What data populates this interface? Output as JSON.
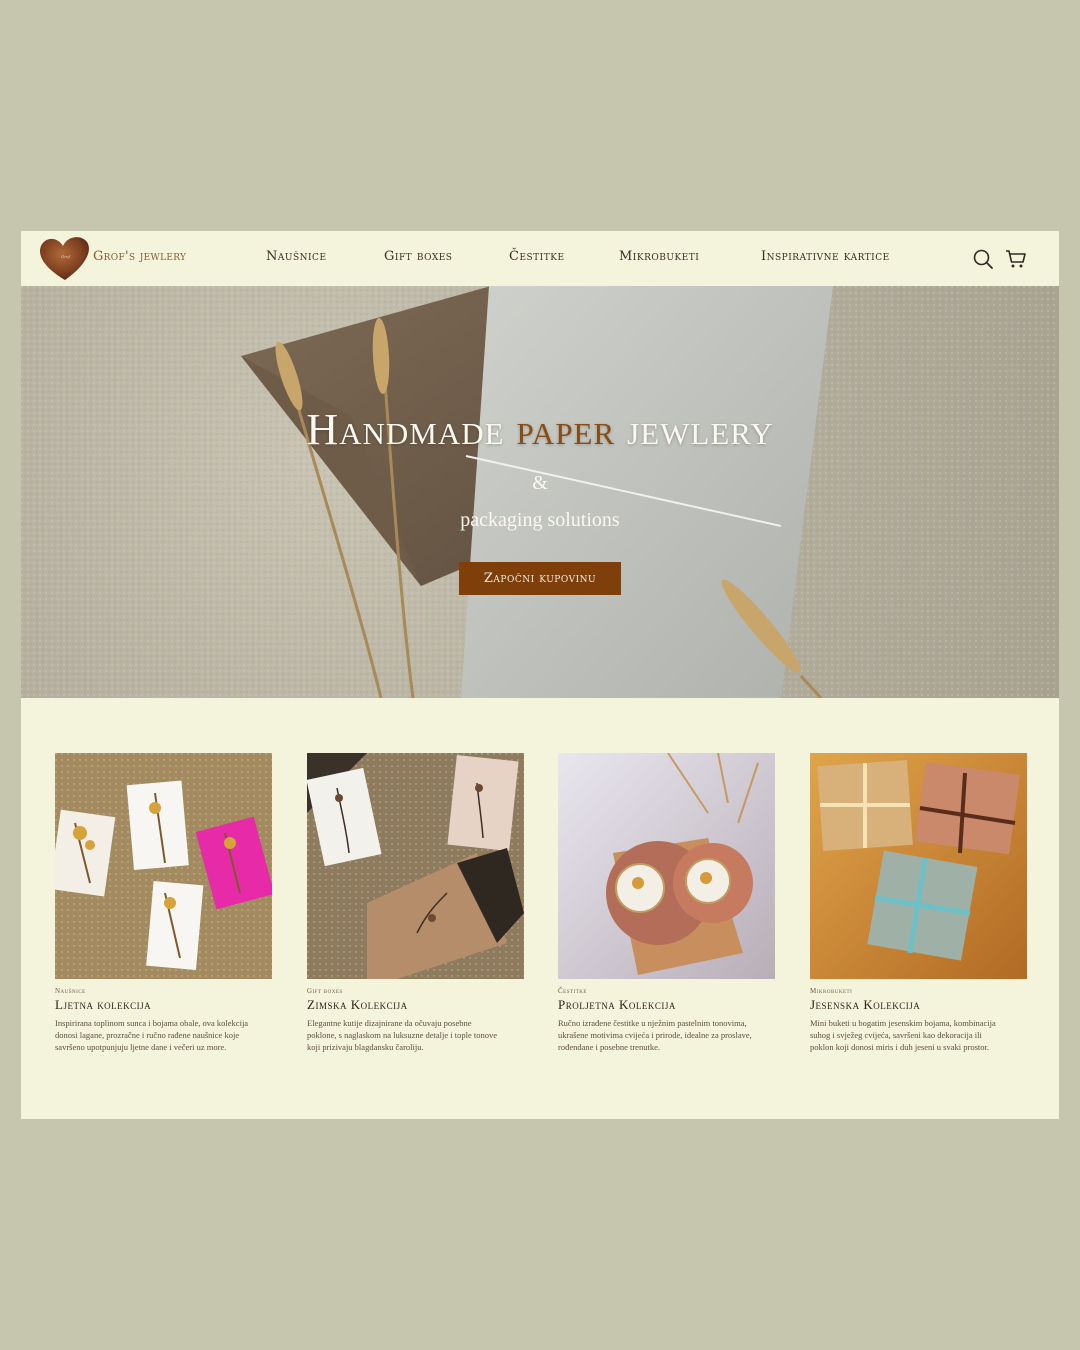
{
  "brand": {
    "name": "Grof's jewlery",
    "logo_icon": "heart-logo-icon"
  },
  "nav": {
    "items": [
      {
        "label": "Naušnice"
      },
      {
        "label": "Gift boxes"
      },
      {
        "label": "Čestitke"
      },
      {
        "label": "Mikrobuketi"
      },
      {
        "label": "Inspirativne kartice"
      }
    ],
    "icons": [
      "search-icon",
      "cart-icon"
    ]
  },
  "hero": {
    "title_part1": "Handmade ",
    "title_accent": "paper",
    "title_part2": " jewlery",
    "amp": "&",
    "subtitle": "packaging solutions",
    "cta_label": "Započni kupovinu"
  },
  "cards": [
    {
      "category": "Naušnice",
      "title": "Ljetna kolekcija",
      "description": "Inspirirana toplinom sunca i bojama obale, ova kolekcija donosi lagane, prozračne i ručno rađene naušnice koje savršeno upotpunjuju ljetne dane i večeri uz more."
    },
    {
      "category": "Gift boxes",
      "title": "Zimska Kolekcija",
      "description": "Elegantne kutije dizajnirane da očuvaju posebne poklone, s naglaskom na luksuzne detalje i tople tonove koji prizivaju blagdansku čaroliju."
    },
    {
      "category": "Čestitke",
      "title": "Proljetna Kolekcija",
      "description": "Ručno izrađene čestitke u nježnim pastelnim tonovima, ukrašene motivima cvijeća i prirode, idealne za proslave, rođendane i posebne trenutke."
    },
    {
      "category": "Mikrobuketi",
      "title": "Jesenska Kolekcija",
      "description": "Mini buketi u bogatim jesenskim bojama, kombinacija suhog i svježeg cvijeća, savršeni kao dekoracija ili poklon koji donosi miris i duh jeseni u svaki prostor."
    }
  ],
  "colors": {
    "page_bg": "#c6c5ae",
    "panel_bg": "#f4f3dc",
    "accent": "#8a4c12",
    "cta_bg": "#7f3f0a"
  }
}
